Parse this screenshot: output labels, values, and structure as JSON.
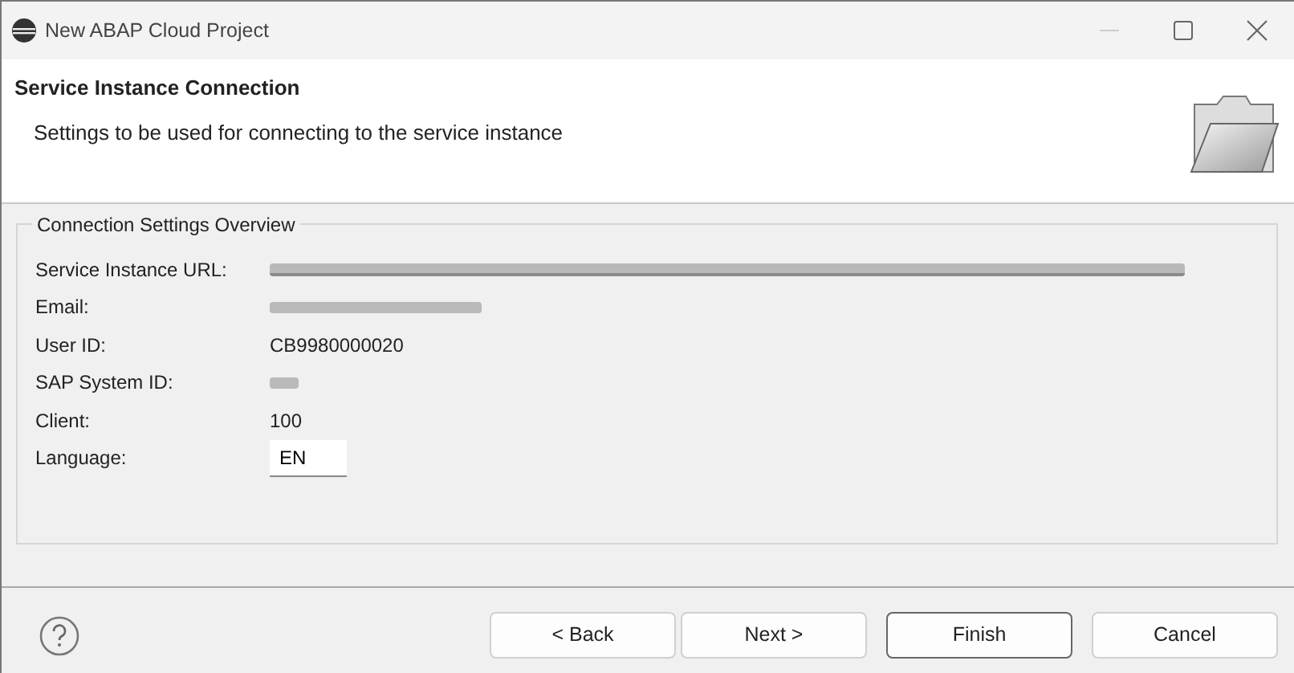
{
  "window": {
    "title": "New ABAP Cloud Project"
  },
  "header": {
    "title": "Service Instance Connection",
    "description": "Settings to be used for connecting to the service instance"
  },
  "group": {
    "title": "Connection Settings Overview",
    "fields": [
      {
        "label": "Service Instance URL:",
        "kind": "redacted-link"
      },
      {
        "label": "Email:",
        "kind": "redacted-text"
      },
      {
        "label": "User ID:",
        "value": "CB9980000020",
        "kind": "text"
      },
      {
        "label": "SAP System ID:",
        "kind": "redacted-short"
      },
      {
        "label": "Client:",
        "value": "100",
        "kind": "text"
      },
      {
        "label": "Language:",
        "value": "EN",
        "kind": "field"
      }
    ]
  },
  "buttons": [
    {
      "label": "< Back",
      "default": false
    },
    {
      "label": "Next >",
      "default": false
    },
    {
      "label": "Finish",
      "default": true
    },
    {
      "label": "Cancel",
      "default": false
    }
  ]
}
